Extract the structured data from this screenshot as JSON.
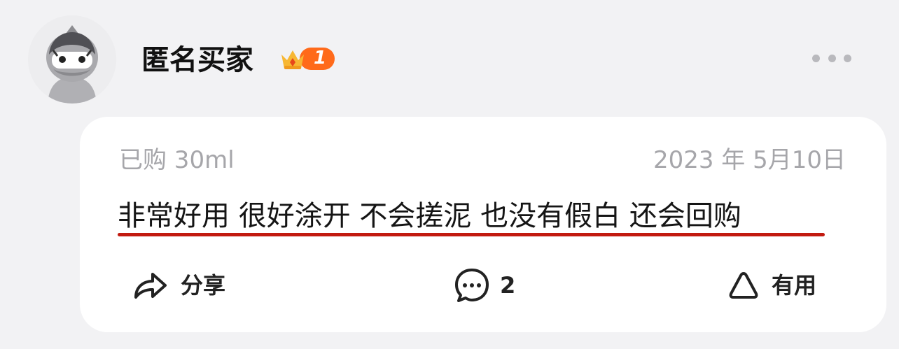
{
  "reviewer": {
    "name": "匿名买家",
    "level": "1",
    "avatar_icon": "anonymous-ninja-avatar",
    "badge_icon": "crown-badge-icon"
  },
  "review": {
    "purchase_spec": "已购 30ml",
    "date": "2023 年 5月10日",
    "text": "非常好用 很好涂开 不会搓泥 也没有假白 还会回购"
  },
  "actions": {
    "share_label": "分享",
    "comment_count": "2",
    "helpful_label": "有用"
  },
  "icons": {
    "more": "more-dots-icon",
    "share": "share-arrow-icon",
    "comment": "comment-bubble-icon",
    "helpful": "triangle-thumb-icon"
  },
  "colors": {
    "page_background": "#f2f2f4",
    "card_background": "#ffffff",
    "underline": "#c21a10",
    "badge_orange": "#ff6a1a",
    "muted_text": "#a6a6aa"
  }
}
